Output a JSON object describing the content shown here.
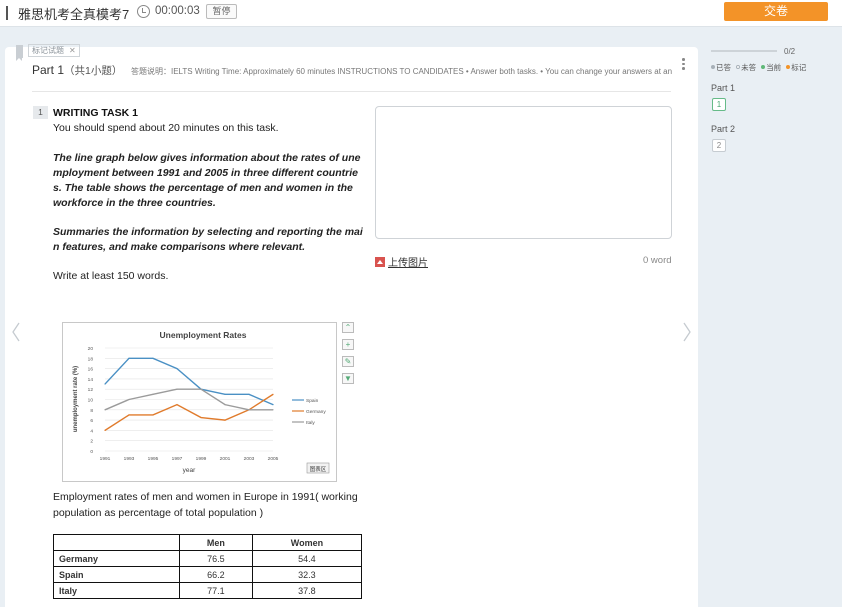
{
  "header": {
    "title": "雅思机考全真模考7",
    "timer": "00:00:03",
    "pause_label": "暂停",
    "submit_label": "交卷"
  },
  "part": {
    "mark_tag": "标记试题",
    "title": "Part 1",
    "subtitle": "（共1小题）",
    "instructions": "答题说明：IELTS Writing Time: Approximately 60 minutes INSTRUCTIONS TO CANDIDATES • Answer both tasks. • You can change your answers at any ..."
  },
  "question": {
    "number": "1",
    "title": "WRITING TASK 1",
    "time_note": "You should spend about 20 minutes on this task.",
    "prompt": "The line graph below gives information about the rates of unemployment between 1991 and 2005 in three different countries. The table shows the percentage of men and women in the workforce in the three countries.",
    "summary": "Summaries the information by selecting and reporting the main features, and make comparisons where relevant.",
    "word_req": "Write at least 150 words.",
    "caption": "Employment rates of men and women in Europe in 1991( working population as percentage of total population )"
  },
  "chart_data": {
    "type": "line",
    "title": "Unemployment Rates",
    "xlabel": "year",
    "ylabel": "unemployment rate (%)",
    "x": [
      1991,
      1993,
      1995,
      1997,
      1999,
      2001,
      2003,
      2005
    ],
    "ylim": [
      0,
      20
    ],
    "yticks": [
      0,
      2,
      4,
      6,
      8,
      10,
      12,
      14,
      16,
      18,
      20
    ],
    "grid": true,
    "legend": "right",
    "series": [
      {
        "name": "Spain",
        "color": "#4a90c4",
        "values": [
          13,
          18,
          18,
          16,
          12,
          11,
          11,
          9
        ]
      },
      {
        "name": "Germany",
        "color": "#e07b2c",
        "values": [
          4,
          7,
          7,
          9,
          6.5,
          6,
          8,
          11
        ]
      },
      {
        "name": "Italy",
        "color": "#9b9b9b",
        "values": [
          8,
          10,
          11,
          12,
          12,
          9,
          8,
          8
        ]
      }
    ],
    "badge": "图表区"
  },
  "table": {
    "headers": [
      "",
      "Men",
      "Women"
    ],
    "rows": [
      [
        "Germany",
        "76.5",
        "54.4"
      ],
      [
        "Spain",
        "66.2",
        "32.3"
      ],
      [
        "Italy",
        "77.1",
        "37.8"
      ]
    ]
  },
  "answer": {
    "upload_label": "上传图片",
    "word_count": "0 word"
  },
  "sidebar": {
    "progress_text": "0/2",
    "progress_fraction": 0,
    "legend": {
      "answered": "已答",
      "unanswered": "未答",
      "current": "当前",
      "marked": "标记"
    },
    "parts": [
      {
        "label": "Part 1",
        "questions": [
          "1"
        ]
      },
      {
        "label": "Part 2",
        "questions": [
          "2"
        ]
      }
    ]
  },
  "colors": {
    "accent": "#f39328",
    "current": "#5fb878",
    "marked": "#f39328"
  }
}
